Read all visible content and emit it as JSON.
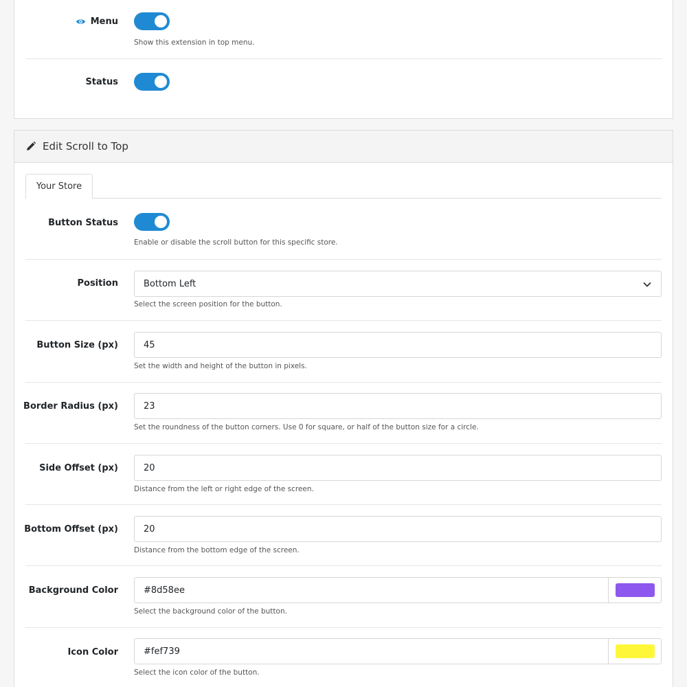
{
  "top_section": {
    "menu_label": "Menu",
    "menu_help": "Show this extension in top menu.",
    "status_label": "Status"
  },
  "edit_panel": {
    "title": "Edit Scroll to Top",
    "tabs": [
      {
        "label": "Your Store"
      }
    ],
    "fields": {
      "button_status": {
        "label": "Button Status",
        "help": "Enable or disable the scroll button for this specific store."
      },
      "position": {
        "label": "Position",
        "value": "Bottom Left",
        "help": "Select the screen position for the button."
      },
      "button_size": {
        "label": "Button Size (px)",
        "value": "45",
        "help": "Set the width and height of the button in pixels."
      },
      "border_radius": {
        "label": "Border Radius (px)",
        "value": "23",
        "help": "Set the roundness of the button corners. Use 0 for square, or half of the button size for a circle."
      },
      "side_offset": {
        "label": "Side Offset (px)",
        "value": "20",
        "help": "Distance from the left or right edge of the screen."
      },
      "bottom_offset": {
        "label": "Bottom Offset (px)",
        "value": "20",
        "help": "Distance from the bottom edge of the screen."
      },
      "background_color": {
        "label": "Background Color",
        "value": "#8d58ee",
        "help": "Select the background color of the button."
      },
      "icon_color": {
        "label": "Icon Color",
        "value": "#fef739",
        "help": "Select the icon color of the button."
      }
    }
  },
  "colors": {
    "accent": "#1f8ad3",
    "bg_swatch": "#8d58ee",
    "icon_swatch": "#fef739"
  },
  "icons": {
    "menu": "eye-icon",
    "panel_header": "pencil-icon",
    "select": "chevron-down-icon"
  }
}
